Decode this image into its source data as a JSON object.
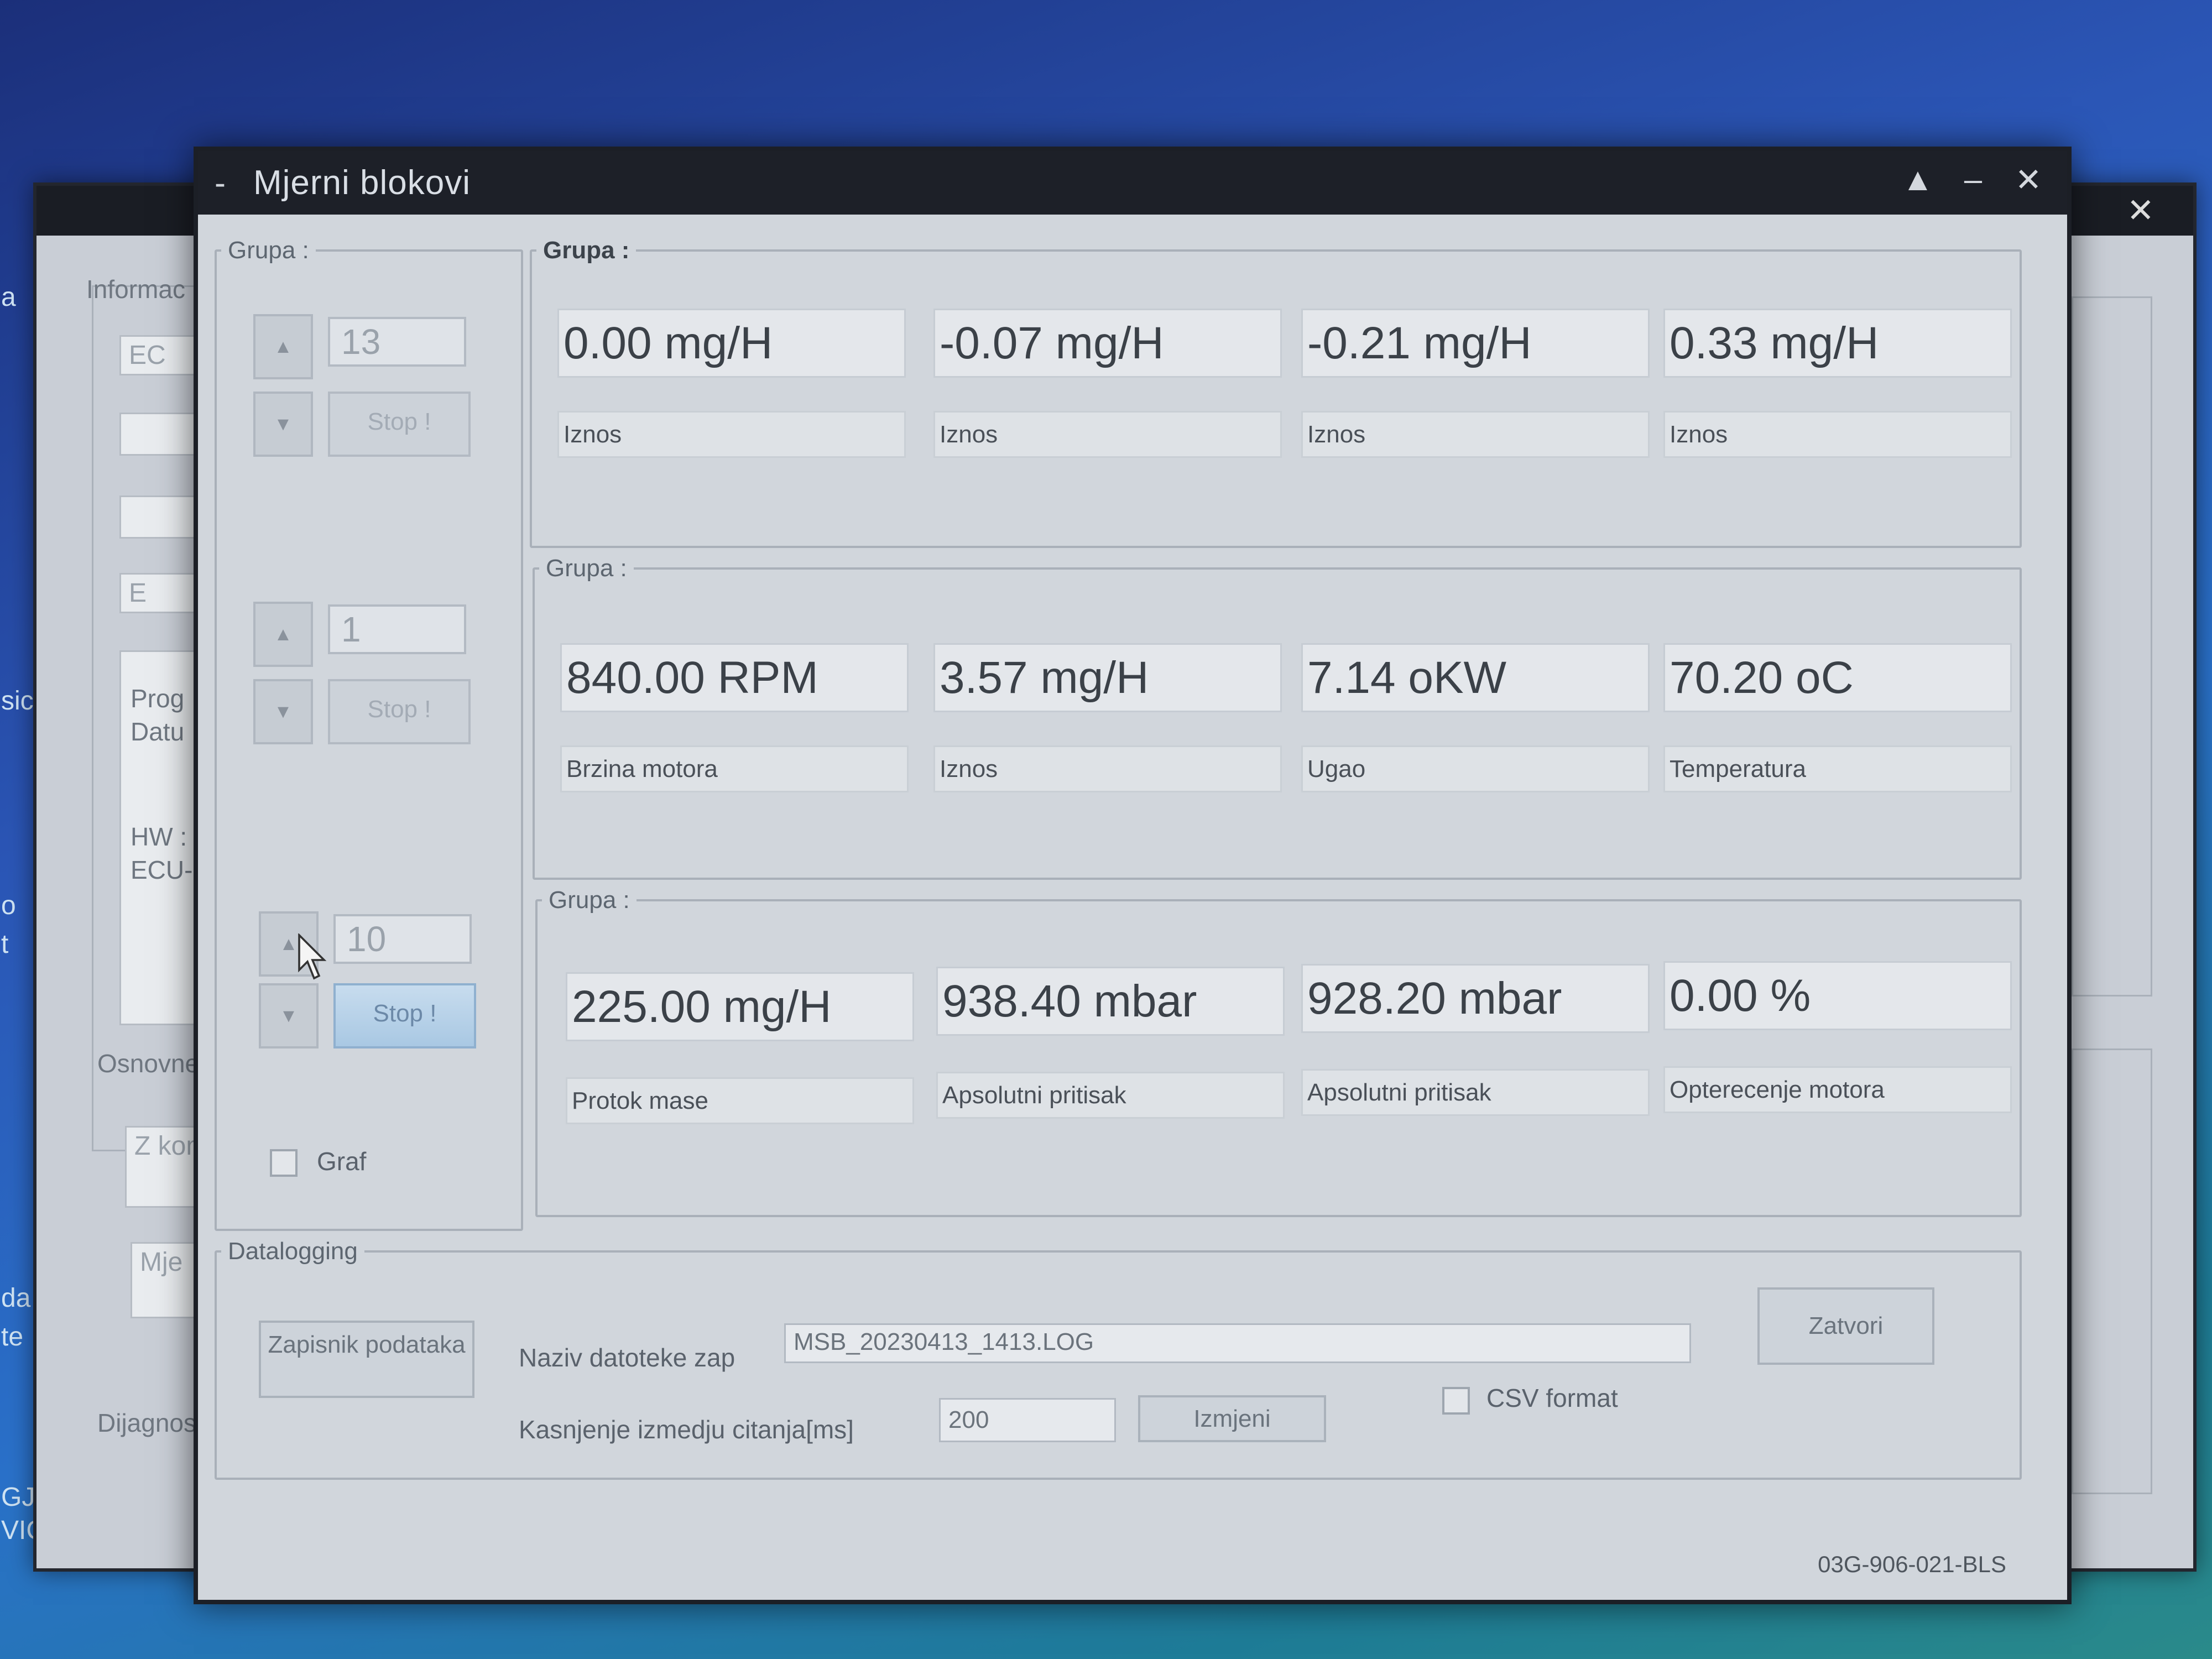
{
  "window": {
    "title": "Mjerni blokovi",
    "sysmenu": "-",
    "controls": [
      "▲",
      "–",
      "✕"
    ]
  },
  "left_panel": {
    "legend": "Grupa :",
    "groups": [
      {
        "number": "13",
        "stop_label": "Stop !"
      },
      {
        "number": "1",
        "stop_label": "Stop !"
      },
      {
        "number": "10",
        "stop_label": "Stop !"
      }
    ],
    "graf_label": "Graf",
    "graf_checked": false
  },
  "groups": [
    {
      "legend": "Grupa :",
      "values": [
        "0.00 mg/H",
        "-0.07 mg/H",
        "-0.21 mg/H",
        "0.33 mg/H"
      ],
      "labels": [
        "Iznos",
        "Iznos",
        "Iznos",
        "Iznos"
      ]
    },
    {
      "legend": "Grupa :",
      "values": [
        "840.00 RPM",
        "3.57 mg/H",
        "7.14 oKW",
        "70.20 oC"
      ],
      "labels": [
        "Brzina motora",
        "Iznos",
        "Ugao",
        "Temperatura"
      ]
    },
    {
      "legend": "Grupa :",
      "values": [
        "225.00 mg/H",
        "938.40 mbar",
        "928.20 mbar",
        "0.00 %"
      ],
      "labels": [
        "Protok mase",
        "Apsolutni pritisak",
        "Apsolutni pritisak",
        "Opterecenje motora"
      ]
    }
  ],
  "datalogging": {
    "legend": "Datalogging",
    "record_button": "Zapisnik podataka",
    "filename_label": "Naziv datoteke zap",
    "filename_value": "MSB_20230413_1413.LOG",
    "delay_label": "Kasnjenje izmedju citanja[ms]",
    "delay_value": "200",
    "change_button": "Izmjeni",
    "csv_label": "CSV format",
    "csv_checked": false,
    "close_button": "Zatvori"
  },
  "status": {
    "part_number": "03G-906-021-BLS"
  },
  "background_window": {
    "labels": [
      "Informac",
      "EC",
      "E",
      "Prog",
      "Datu",
      "HW :",
      "ECU-",
      "Osnovne",
      "Z kom",
      "Mje",
      "Dijagnosti"
    ]
  },
  "desktop": {
    "labels": [
      "a",
      "sic,",
      "o",
      "t",
      "da",
      "te",
      "GJA",
      "VIC"
    ]
  }
}
